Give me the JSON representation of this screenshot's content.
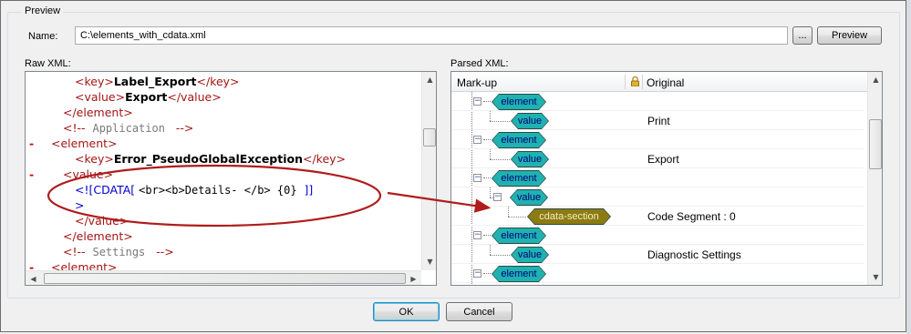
{
  "preview_group": {
    "title": "Preview"
  },
  "name_field": {
    "label": "Name:",
    "value": "C:\\elements_with_cdata.xml"
  },
  "browse_button": {
    "label": "..."
  },
  "preview_button": {
    "label": "Preview"
  },
  "raw_xml": {
    "label": "Raw XML:",
    "lines": [
      {
        "indent": 2,
        "open": "<key>",
        "text": "Label_Export",
        "close": "</key>"
      },
      {
        "indent": 2,
        "open": "<value>",
        "text": "Export",
        "close": "</value>"
      },
      {
        "indent": 1,
        "open": "</element>"
      },
      {
        "indent": 1,
        "comment_open": "<!--",
        "comment_text": "Application",
        "comment_close": "-->"
      },
      {
        "minus": "-",
        "indent": 0,
        "open": "<element>"
      },
      {
        "indent": 2,
        "open": "<key>",
        "text": "Error_PseudoGlobalException",
        "close": "</key>"
      },
      {
        "minus": "-",
        "indent": 1,
        "open": "<value>"
      },
      {
        "indent": 2,
        "cdata_open": "<![CDATA[",
        "cdata_text": "<br><b>Details- </b> {0}",
        "cdata_close": "]]"
      },
      {
        "indent": 2,
        "cdata_end": ">"
      },
      {
        "indent": 2,
        "open": "</value>"
      },
      {
        "indent": 1,
        "open": "</element>"
      },
      {
        "indent": 1,
        "comment_open": "<!--",
        "comment_text": "Settings",
        "comment_close": "-->"
      },
      {
        "minus": "-",
        "indent": 0,
        "open": "<element>"
      }
    ]
  },
  "parsed_xml": {
    "label": "Parsed XML:",
    "columns": {
      "markup": "Mark-up",
      "original": "Original"
    },
    "rows": [
      {
        "node": "element",
        "original": "",
        "kind": "element"
      },
      {
        "node": "value",
        "original": "Print",
        "kind": "value"
      },
      {
        "node": "element",
        "original": "",
        "kind": "element"
      },
      {
        "node": "value",
        "original": "Export",
        "kind": "value"
      },
      {
        "node": "element",
        "original": "",
        "kind": "element"
      },
      {
        "node": "value",
        "original": "",
        "kind": "value-expanded"
      },
      {
        "node": "cdata-section",
        "original": "Code Segment : 0",
        "kind": "cdata"
      },
      {
        "node": "element",
        "original": "",
        "kind": "element"
      },
      {
        "node": "value",
        "original": "Diagnostic Settings",
        "kind": "value"
      },
      {
        "node": "element",
        "original": "",
        "kind": "element"
      }
    ]
  },
  "ok_button": {
    "label": "OK"
  },
  "cancel_button": {
    "label": "Cancel"
  },
  "colors": {
    "tag": "#a31515",
    "node_teal": "#1fb2b0",
    "node_cdata": "#8c7a12",
    "annotation": "#b01c1c"
  },
  "icons": {
    "lock": "lock-icon",
    "annotation": "red-ellipse-and-arrow"
  }
}
